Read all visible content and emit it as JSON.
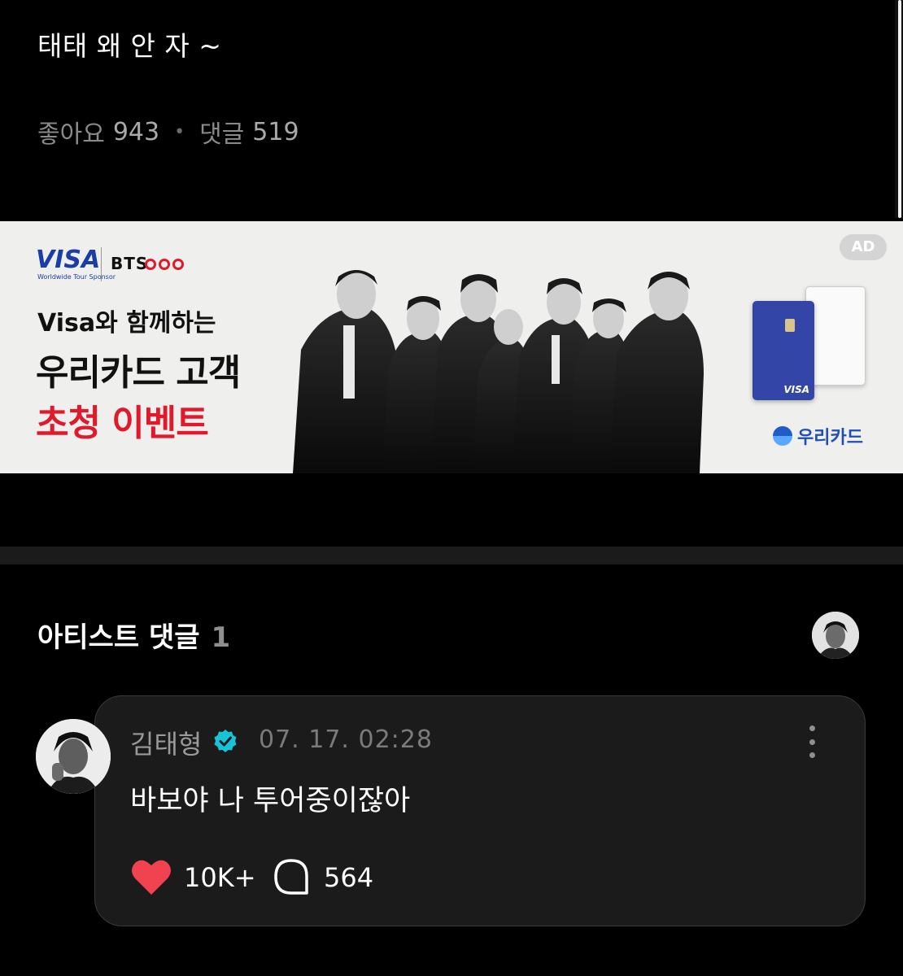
{
  "post": {
    "text": "태태 왜 안 자 ~",
    "likes_label": "좋아요",
    "likes_count": "943",
    "comments_label": "댓글",
    "comments_count": "519"
  },
  "ad": {
    "visa_logo": "VISA",
    "visa_sub": "Worldwide Tour Sponsor",
    "bts_logo": "BTS",
    "line1": "Visa와 함께하는",
    "line2": "우리카드 고객",
    "line3": "초청 이벤트",
    "badge": "AD",
    "card_brand": "VISA",
    "sponsor": "우리카드"
  },
  "artist_comments": {
    "title": "아티스트 댓글",
    "count": "1"
  },
  "comment": {
    "author": "김태형",
    "time": "07. 17. 02:28",
    "text": "바보야 나 투어중이잖아",
    "likes": "10K+",
    "replies": "564"
  },
  "colors": {
    "background": "#000000",
    "card": "#1b1b1b",
    "heart": "#f0424f",
    "verified": "#19c3d6",
    "ad_red": "#e0192b",
    "visa_blue": "#1a3da8"
  }
}
